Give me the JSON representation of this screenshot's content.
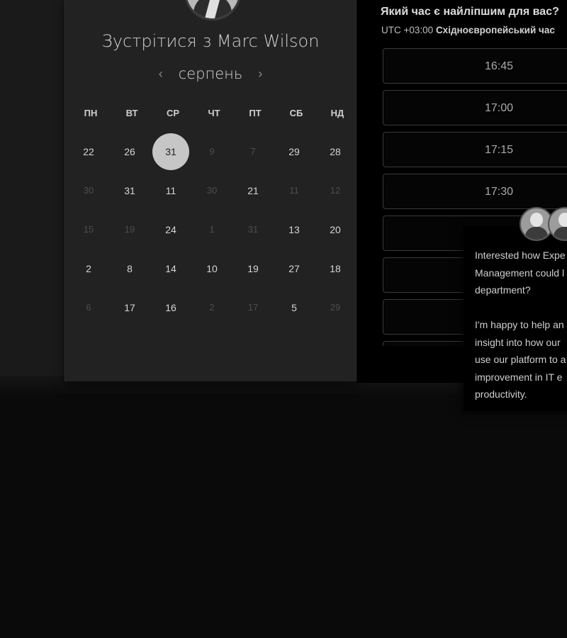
{
  "booking": {
    "title": "Зустрітися з Marc Wilson",
    "month": "серпень",
    "prev_icon": "‹",
    "next_icon": "›",
    "weekdays": [
      "ПН",
      "ВТ",
      "СР",
      "ЧТ",
      "ПТ",
      "СБ",
      "НД"
    ],
    "weeks": [
      [
        {
          "d": "22"
        },
        {
          "d": "26"
        },
        {
          "d": "31",
          "selected": true
        },
        {
          "d": "9",
          "dim": true
        },
        {
          "d": "7",
          "dim": true
        },
        {
          "d": "29"
        },
        {
          "d": "28"
        }
      ],
      [
        {
          "d": "30",
          "dim": true
        },
        {
          "d": "31"
        },
        {
          "d": "11"
        },
        {
          "d": "30",
          "dim": true
        },
        {
          "d": "21"
        },
        {
          "d": "11",
          "dim": true
        },
        {
          "d": "12",
          "dim": true
        }
      ],
      [
        {
          "d": "15",
          "dim": true
        },
        {
          "d": "19",
          "dim": true
        },
        {
          "d": "24"
        },
        {
          "d": "1",
          "dim": true
        },
        {
          "d": "31",
          "dim": true
        },
        {
          "d": "13"
        },
        {
          "d": "20"
        }
      ],
      [
        {
          "d": "2"
        },
        {
          "d": "8"
        },
        {
          "d": "14"
        },
        {
          "d": "10"
        },
        {
          "d": "19"
        },
        {
          "d": "27"
        },
        {
          "d": "18"
        }
      ],
      [
        {
          "d": "6",
          "dim": true
        },
        {
          "d": "17"
        },
        {
          "d": "16"
        },
        {
          "d": "2",
          "dim": true
        },
        {
          "d": "17",
          "dim": true
        },
        {
          "d": "5"
        },
        {
          "d": "29",
          "dim": true
        }
      ]
    ]
  },
  "times": {
    "heading": "Який час є найліпшим для вас?",
    "tz_offset": "UTC +03:00",
    "tz_name": "Східноєвропейський час",
    "slots": [
      "16:45",
      "17:00",
      "17:15",
      "17:30",
      "",
      "",
      "",
      ""
    ]
  },
  "chat": {
    "lines": [
      "Interested how Expe",
      "Management could l",
      "department?",
      "",
      "I'm happy to help an",
      "insight into how our",
      "use our platform to a",
      "improvement in IT e",
      "productivity."
    ]
  },
  "icons": {
    "host_avatar": "avatar",
    "chat_avatars": [
      "avatar",
      "avatar"
    ]
  }
}
